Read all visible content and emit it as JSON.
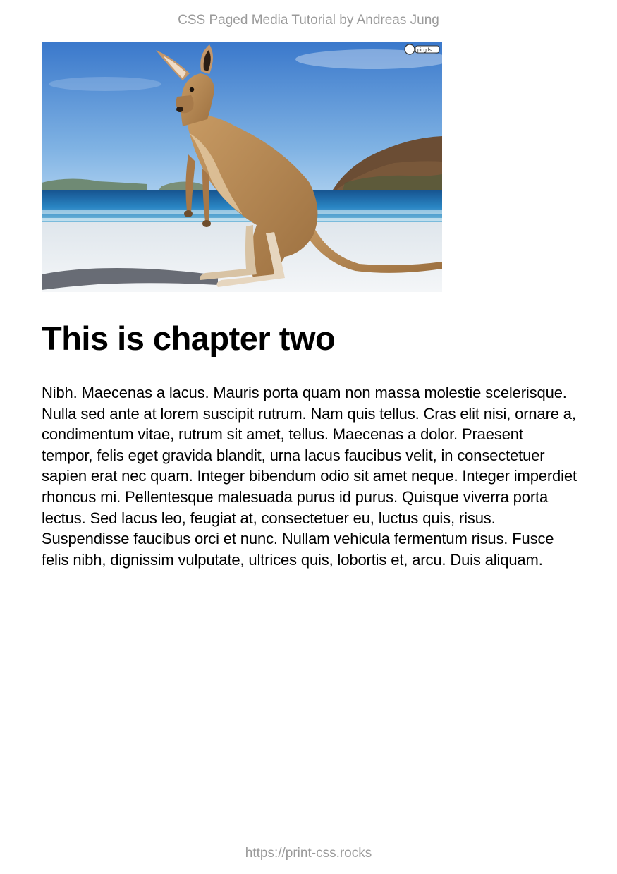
{
  "header": {
    "running_title": "CSS Paged Media Tutorial by Andreas Jung"
  },
  "figure": {
    "subject": "kangaroo on a beach",
    "watermark_text": "picgifs"
  },
  "chapter": {
    "title": "This is chapter two",
    "paragraph": "Nibh. Maecenas a lacus. Mauris porta quam non massa molestie scelerisque. Nulla sed ante at lorem suscipit rutrum. Nam quis tellus. Cras elit nisi, ornare a, condimentum vitae, rutrum sit amet, tellus. Maecenas a dolor. Praesent tempor, felis eget gravida blandit, urna lacus faucibus velit, in consectetuer sapien erat nec quam. Integer bibendum odio sit amet neque. Integer imperdiet rhoncus mi. Pellentesque malesuada purus id purus. Quisque viverra porta lectus. Sed lacus leo, feugiat at, consectetuer eu, luctus quis, risus. Suspendisse faucibus orci et nunc. Nullam vehicula fermentum risus. Fusce felis nibh, dignissim vulputate, ultrices quis, lobortis et, arcu. Duis aliquam."
  },
  "footer": {
    "url": "https://print-css.rocks"
  },
  "colors": {
    "sky": "#3f7fce",
    "sea": "#1f6fb3",
    "sand": "#eef1f4",
    "kangaroo": "#b98a55",
    "running_text": "#9a9a9a"
  }
}
